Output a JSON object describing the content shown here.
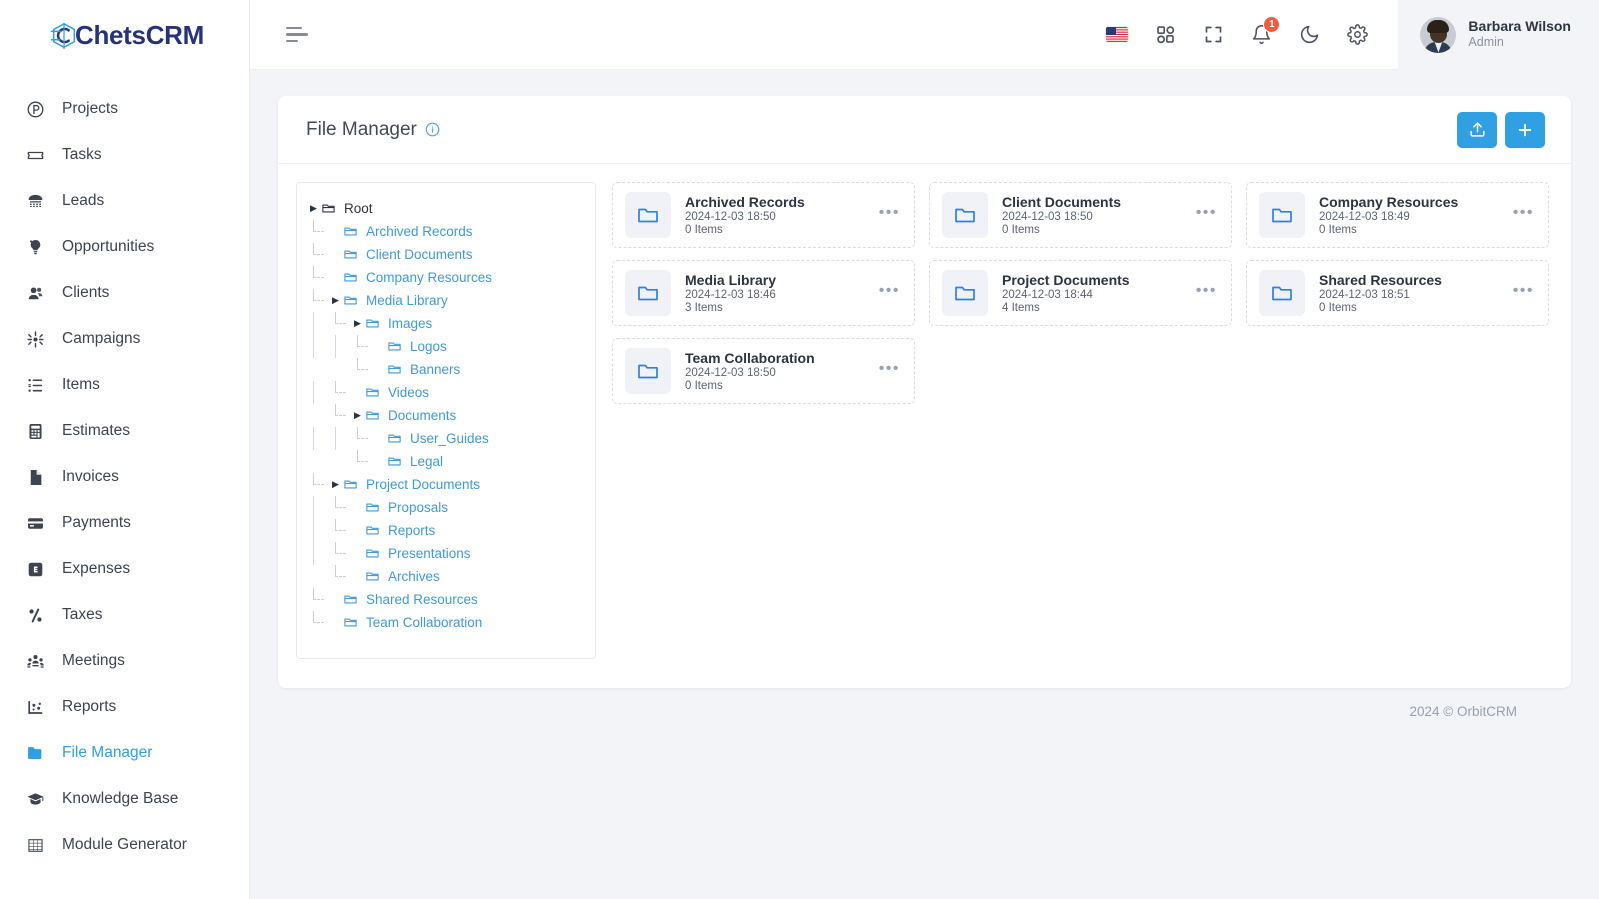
{
  "brand": {
    "name": "ChetsCRM",
    "mark_icon": "chets-logo-icon"
  },
  "sidebar": {
    "items": [
      {
        "label": "Projects",
        "icon": "projects-icon",
        "active": false
      },
      {
        "label": "Tasks",
        "icon": "ticket-icon",
        "active": false
      },
      {
        "label": "Leads",
        "icon": "telephone-icon",
        "active": false
      },
      {
        "label": "Opportunities",
        "icon": "lightbulb-icon",
        "active": false
      },
      {
        "label": "Clients",
        "icon": "users-icon",
        "active": false
      },
      {
        "label": "Campaigns",
        "icon": "campaign-icon",
        "active": false
      },
      {
        "label": "Items",
        "icon": "list-icon",
        "active": false
      },
      {
        "label": "Estimates",
        "icon": "calculator-icon",
        "active": false
      },
      {
        "label": "Invoices",
        "icon": "document-icon",
        "active": false
      },
      {
        "label": "Payments",
        "icon": "card-icon",
        "active": false
      },
      {
        "label": "Expenses",
        "icon": "expense-icon",
        "active": false
      },
      {
        "label": "Taxes",
        "icon": "percent-icon",
        "active": false
      },
      {
        "label": "Meetings",
        "icon": "meetings-icon",
        "active": false
      },
      {
        "label": "Reports",
        "icon": "chart-icon",
        "active": false
      },
      {
        "label": "File Manager",
        "icon": "folder-icon",
        "active": true
      },
      {
        "label": "Knowledge Base",
        "icon": "graduation-cap-icon",
        "active": false
      },
      {
        "label": "Module Generator",
        "icon": "grid-table-icon",
        "active": false
      }
    ]
  },
  "topbar": {
    "menu_toggle_icon": "hamburger-icon",
    "icons": [
      {
        "name": "language-flag-us-icon"
      },
      {
        "name": "apps-grid-icon"
      },
      {
        "name": "fullscreen-icon"
      },
      {
        "name": "notifications-bell-icon",
        "badge": "1"
      },
      {
        "name": "dark-mode-moon-icon"
      },
      {
        "name": "settings-gear-icon"
      }
    ],
    "profile": {
      "name": "Barbara Wilson",
      "role": "Admin",
      "avatar_icon": "user-avatar"
    }
  },
  "page": {
    "title": "File Manager",
    "info_icon": "info-circle-icon",
    "actions": [
      {
        "name": "upload-button",
        "icon": "upload-icon",
        "color": "#31a0e2"
      },
      {
        "name": "add-button",
        "icon": "plus-icon",
        "color": "#31a0e2"
      }
    ]
  },
  "tree": {
    "nodes": [
      {
        "label": "Root",
        "depth": 0,
        "caret": "collapsed",
        "root": true,
        "last": false
      },
      {
        "label": "Archived Records",
        "depth": 1,
        "caret": "none",
        "root": false,
        "last": false
      },
      {
        "label": "Client Documents",
        "depth": 1,
        "caret": "none",
        "root": false,
        "last": false
      },
      {
        "label": "Company Resources",
        "depth": 1,
        "caret": "none",
        "root": false,
        "last": false
      },
      {
        "label": "Media Library",
        "depth": 1,
        "caret": "collapsed",
        "root": false,
        "last": false
      },
      {
        "label": "Images",
        "depth": 2,
        "caret": "collapsed",
        "root": false,
        "last": false
      },
      {
        "label": "Logos",
        "depth": 3,
        "caret": "none",
        "root": false,
        "last": false
      },
      {
        "label": "Banners",
        "depth": 3,
        "caret": "none",
        "root": false,
        "last": true
      },
      {
        "label": "Videos",
        "depth": 2,
        "caret": "none",
        "root": false,
        "last": false
      },
      {
        "label": "Documents",
        "depth": 2,
        "caret": "collapsed",
        "root": false,
        "last": true
      },
      {
        "label": "User_Guides",
        "depth": 3,
        "caret": "none",
        "root": false,
        "last": false
      },
      {
        "label": "Legal",
        "depth": 3,
        "caret": "none",
        "root": false,
        "last": true
      },
      {
        "label": "Project Documents",
        "depth": 1,
        "caret": "collapsed",
        "root": false,
        "last": false
      },
      {
        "label": "Proposals",
        "depth": 2,
        "caret": "none",
        "root": false,
        "last": false
      },
      {
        "label": "Reports",
        "depth": 2,
        "caret": "none",
        "root": false,
        "last": false
      },
      {
        "label": "Presentations",
        "depth": 2,
        "caret": "none",
        "root": false,
        "last": false
      },
      {
        "label": "Archives",
        "depth": 2,
        "caret": "none",
        "root": false,
        "last": true
      },
      {
        "label": "Shared Resources",
        "depth": 1,
        "caret": "none",
        "root": false,
        "last": false
      },
      {
        "label": "Team Collaboration",
        "depth": 1,
        "caret": "none",
        "root": false,
        "last": true
      }
    ]
  },
  "folders": [
    {
      "name": "Archived Records",
      "date": "2024-12-03 18:50",
      "items": "0 Items"
    },
    {
      "name": "Client Documents",
      "date": "2024-12-03 18:50",
      "items": "0 Items"
    },
    {
      "name": "Company Resources",
      "date": "2024-12-03 18:49",
      "items": "0 Items"
    },
    {
      "name": "Media Library",
      "date": "2024-12-03 18:46",
      "items": "3 Items"
    },
    {
      "name": "Project Documents",
      "date": "2024-12-03 18:44",
      "items": "4 Items"
    },
    {
      "name": "Shared Resources",
      "date": "2024-12-03 18:51",
      "items": "0 Items"
    },
    {
      "name": "Team Collaboration",
      "date": "2024-12-03 18:50",
      "items": "0 Items"
    }
  ],
  "footer": {
    "copyright": "2024 © OrbitCRM"
  },
  "colors": {
    "accent": "#31a0e2",
    "link": "#3f9ada",
    "badge": "#f25b3f",
    "brand": "#26337a"
  }
}
